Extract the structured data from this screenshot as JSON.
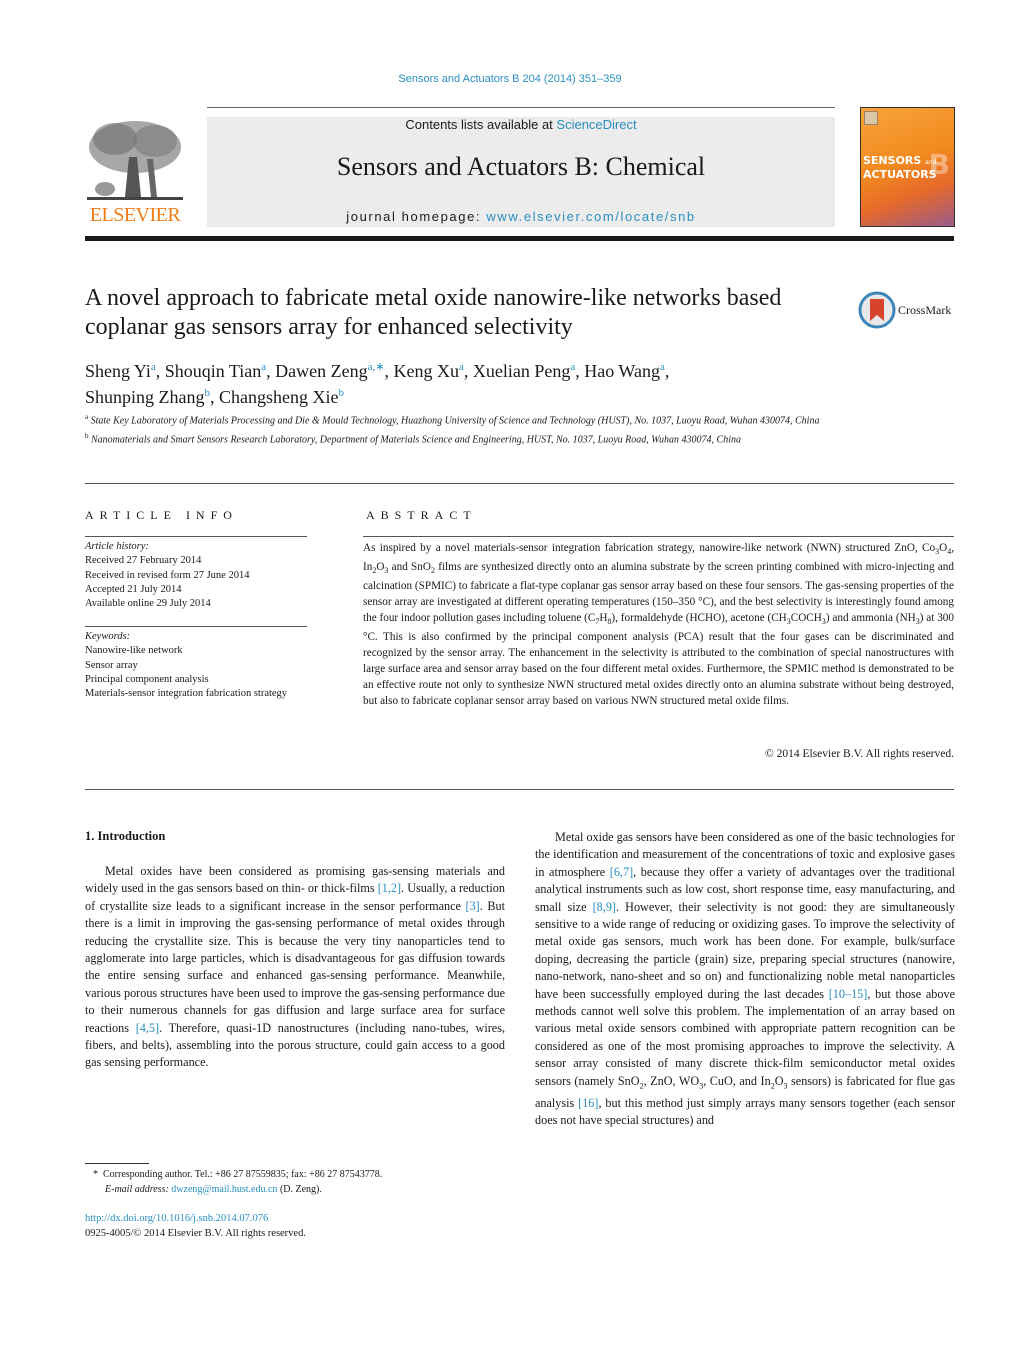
{
  "header": {
    "citation": "Sensors and Actuators B 204 (2014) 351–359",
    "contents_prefix": "Contents lists available at ",
    "contents_link": "ScienceDirect",
    "journal_title": "Sensors and Actuators B: Chemical",
    "homepage_prefix": "journal homepage: ",
    "homepage_link": "www.elsevier.com/locate/snb",
    "publisher_logo_text": "ELSEVIER",
    "cover_line1": "SENSORS",
    "cover_and": "and",
    "cover_line2": "ACTUATORS",
    "cover_letter": "B"
  },
  "article": {
    "title": "A novel approach to fabricate metal oxide nanowire-like networks based coplanar gas sensors array for enhanced selectivity",
    "crossmark_label": "CrossMark",
    "authors": [
      {
        "name": "Sheng Yi",
        "sup": "a",
        "sep": ", "
      },
      {
        "name": "Shouqin Tian",
        "sup": "a",
        "sep": ", "
      },
      {
        "name": "Dawen Zeng",
        "sup": "a,∗",
        "sep": ", "
      },
      {
        "name": "Keng Xu",
        "sup": "a",
        "sep": ", "
      },
      {
        "name": "Xuelian Peng",
        "sup": "a",
        "sep": ", "
      },
      {
        "name": "Hao Wang",
        "sup": "a",
        "sep": ","
      },
      {
        "name": "Shunping Zhang",
        "sup": "b",
        "sep": ", "
      },
      {
        "name": "Changsheng Xie",
        "sup": "b",
        "sep": ""
      }
    ],
    "affiliations": [
      {
        "sup": "a",
        "text": "State Key Laboratory of Materials Processing and Die & Mould Technology, Huazhong University of Science and Technology (HUST), No. 1037, Luoyu Road, Wuhan 430074, China"
      },
      {
        "sup": "b",
        "text": "Nanomaterials and Smart Sensors Research Laboratory, Department of Materials Science and Engineering, HUST, No. 1037, Luoyu Road, Wuhan 430074, China"
      }
    ]
  },
  "article_info": {
    "heading": "ARTICLE INFO",
    "history_label": "Article history:",
    "history": [
      "Received 27 February 2014",
      "Received in revised form 27 June 2014",
      "Accepted 21 July 2014",
      "Available online 29 July 2014"
    ],
    "keywords_label": "Keywords:",
    "keywords": [
      "Nanowire-like network",
      "Sensor array",
      "Principal component analysis",
      "Materials-sensor integration fabrication strategy"
    ]
  },
  "abstract": {
    "heading": "ABSTRACT",
    "p1": "As inspired by a novel materials-sensor integration fabrication strategy, nanowire-like network (NWN) structured ZnO, Co",
    "p2": "O",
    "p3": ", In",
    "p4": "O",
    "p5": " and SnO",
    "p6": " films are synthesized directly onto an alumina substrate by the screen printing combined with micro-injecting and calcination (SPMIC) to fabricate a flat-type coplanar gas sensor array based on these four sensors. The gas-sensing properties of the sensor array are investigated at different operating temperatures (150–350 °C), and the best selectivity is interestingly found among the four indoor pollution gases including toluene (C",
    "p7": "H",
    "p8": "), formaldehyde (HCHO), acetone (CH",
    "p9": "COCH",
    "p10": ") and ammonia (NH",
    "p11": ") at 300 °C. This is also confirmed by the principal component analysis (PCA) result that the four gases can be discriminated and recognized by the sensor array. The enhancement in the selectivity is attributed to the combination of special nanostructures with large surface area and sensor array based on the four different metal oxides. Furthermore, the SPMIC method is demonstrated to be an effective route not only to synthesize NWN structured metal oxides directly onto an alumina substrate without being destroyed, but also to fabricate coplanar sensor array based on various NWN structured metal oxide films.",
    "subs": {
      "s3": "3",
      "s4": "4",
      "s2": "2",
      "s7": "7",
      "s8": "8"
    },
    "copyright": "© 2014 Elsevier B.V. All rights reserved."
  },
  "introduction": {
    "heading": "1.  Introduction",
    "left": {
      "t1": "Metal oxides have been considered as promising gas-sensing materials and widely used in the gas sensors based on thin- or thick-films ",
      "r1": "[1,2]",
      "t2": ". Usually, a reduction of crystallite size leads to a significant increase in the sensor performance ",
      "r2": "[3]",
      "t3": ". But there is a limit in improving the gas-sensing performance of metal oxides through reducing the crystallite size. This is because the very tiny nanoparticles tend to agglomerate into large particles, which is disadvantageous for gas diffusion towards the entire sensing surface and enhanced gas-sensing performance. Meanwhile, various porous structures have been used to improve the gas-sensing performance due to their numerous channels for gas diffusion and large surface area for surface reactions ",
      "r3": "[4,5]",
      "t4": ". Therefore, quasi-1D nanostructures (including nano-tubes, wires, fibers, and belts), assembling into the porous structure, could gain access to a good gas sensing performance."
    },
    "right": {
      "t1": "Metal oxide gas sensors have been considered as one of the basic technologies for the identification and measurement of the concentrations of toxic and explosive gases in atmosphere ",
      "r1": "[6,7]",
      "t2": ", because they offer a variety of advantages over the traditional analytical instruments such as low cost, short response time, easy manufacturing, and small size ",
      "r2": "[8,9]",
      "t3": ". However, their selectivity is not good: they are simultaneously sensitive to a wide range of reducing or oxidizing gases. To improve the selectivity of metal oxide gas sensors, much work has been done. For example, bulk/surface doping, decreasing the particle (grain) size, preparing special structures (nanowire, nano-network, nano-sheet and so on) and functionalizing noble metal nanoparticles have been successfully employed during the last decades ",
      "r3": "[10–15]",
      "t4": ", but those above methods cannot well solve this problem. The implementation of an array based on various metal oxide sensors combined with appropriate pattern recognition can be considered as one of the most promising approaches to improve the selectivity. A sensor array consisted of many discrete thick-film semiconductor metal oxides sensors (namely SnO",
      "t5": ", ZnO, WO",
      "t6": ", CuO, and In",
      "t7": "O",
      "t8": " sensors) is fabricated for flue gas analysis ",
      "r4": "[16]",
      "t9": ", but this method just simply arrays many sensors together (each sensor does not have special structures) and"
    }
  },
  "footnote": {
    "star": "*",
    "corresponding": "Corresponding author. Tel.: +86 27 87559835; fax: +86 27 87543778.",
    "email_label": "E-mail address: ",
    "email": "dwzeng@mail.hust.edu.cn",
    "email_suffix": " (D. Zeng)."
  },
  "footer": {
    "doi": "http://dx.doi.org/10.1016/j.snb.2014.07.076",
    "issn": "0925-4005/© 2014 Elsevier B.V. All rights reserved."
  },
  "colors": {
    "link": "#2a8fc0",
    "elsevier_orange": "#f07c16",
    "header_box": "#ececec"
  }
}
